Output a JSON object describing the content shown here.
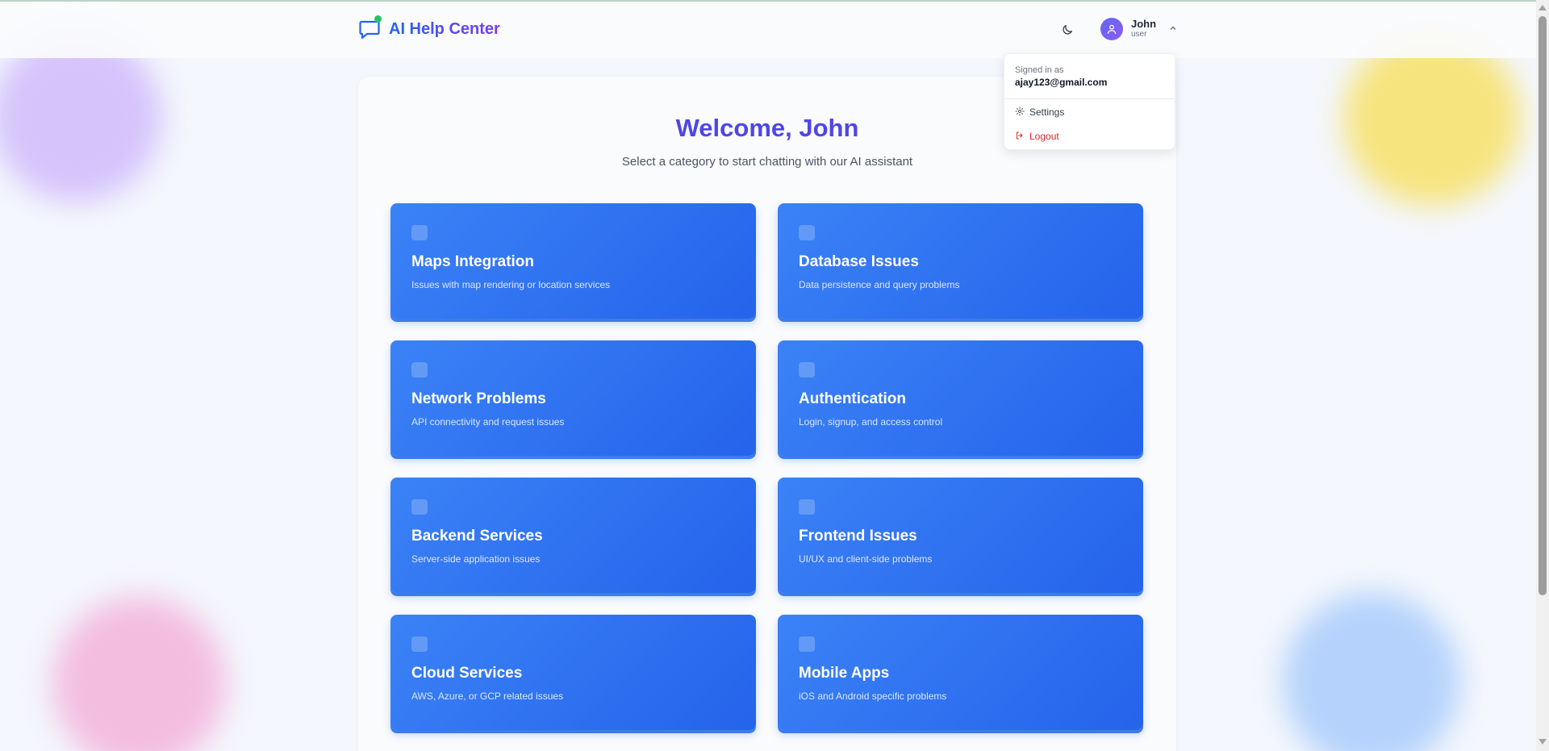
{
  "app": {
    "title": "AI Help Center"
  },
  "header": {
    "theme_toggle": "moon-icon",
    "user": {
      "name": "John",
      "role": "user"
    }
  },
  "dropdown": {
    "signed_in_label": "Signed in as",
    "email": "ajay123@gmail.com",
    "settings_label": "Settings",
    "logout_label": "Logout"
  },
  "main": {
    "welcome": "Welcome, John",
    "subtitle": "Select a category to start chatting with our AI assistant",
    "categories": [
      {
        "title": "Maps Integration",
        "description": "Issues with map rendering or location services"
      },
      {
        "title": "Database Issues",
        "description": "Data persistence and query problems"
      },
      {
        "title": "Network Problems",
        "description": "API connectivity and request issues"
      },
      {
        "title": "Authentication",
        "description": "Login, signup, and access control"
      },
      {
        "title": "Backend Services",
        "description": "Server-side application issues"
      },
      {
        "title": "Frontend Issues",
        "description": "UI/UX and client-side problems"
      },
      {
        "title": "Cloud Services",
        "description": "AWS, Azure, or GCP related issues"
      },
      {
        "title": "Mobile Apps",
        "description": "iOS and Android specific problems"
      }
    ]
  },
  "colors": {
    "brand": "#4f46e5",
    "card": "#3b82f6",
    "logout": "#dc2626",
    "online": "#22c55e"
  }
}
